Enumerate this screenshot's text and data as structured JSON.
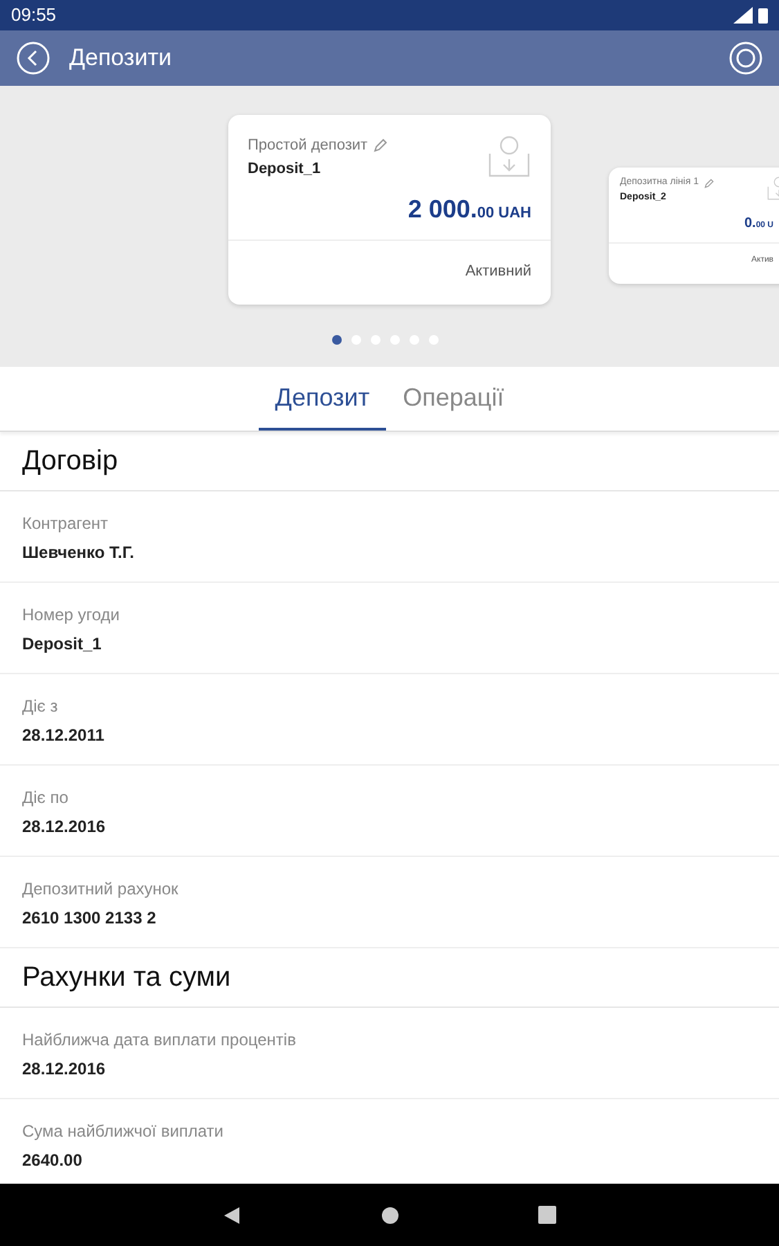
{
  "status_bar": {
    "time": "09:55"
  },
  "app_bar": {
    "title": "Депозити"
  },
  "cards": [
    {
      "type": "Простой депозит",
      "name": "Deposit_1",
      "amount": "2 000.",
      "cents": "00",
      "currency": "UAH",
      "status": "Активний",
      "selected": true
    },
    {
      "type": "Депозитна лінія 1",
      "name": "Deposit_2",
      "amount": "0.",
      "cents": "00",
      "currency": "U",
      "status": "Актив",
      "selected": false
    }
  ],
  "pager": [
    {
      "selected": true
    },
    {
      "selected": false
    },
    {
      "selected": false
    },
    {
      "selected": false
    },
    {
      "selected": false
    },
    {
      "selected": false
    }
  ],
  "tabs": [
    {
      "label": "Депозит",
      "selected": true
    },
    {
      "label": "Операції",
      "selected": false
    }
  ],
  "sections": [
    {
      "title": "Договір",
      "rows": [
        {
          "label": "Контрагент",
          "value": "Шевченко Т.Г."
        },
        {
          "label": "Номер угоди",
          "value": "Deposit_1"
        },
        {
          "label": "Діє з",
          "value": "28.12.2011"
        },
        {
          "label": "Діє по",
          "value": "28.12.2016"
        },
        {
          "label": "Депозитний рахунок",
          "value": "2610 1300 2133 2"
        }
      ]
    },
    {
      "title": "Рахунки та суми",
      "rows": [
        {
          "label": "Найближча дата виплати процентів",
          "value": "28.12.2016"
        },
        {
          "label": "Сума найближчої виплати",
          "value": "2640.00"
        }
      ]
    }
  ]
}
